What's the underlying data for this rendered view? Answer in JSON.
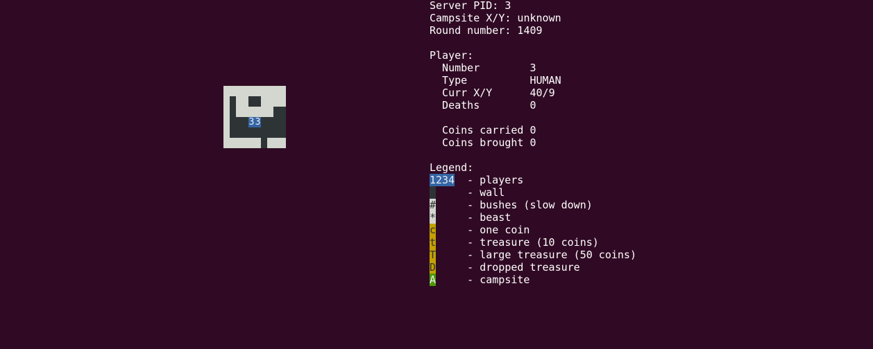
{
  "server": {
    "pid_line": "Server PID: 3",
    "campsite_line": "Campsite X/Y: unknown",
    "round_line": "Round number: 1409"
  },
  "player": {
    "heading": "Player:",
    "number_line": "  Number        3",
    "type_line": "  Type          HUMAN",
    "pos_line": "  Curr X/Y      40/9",
    "deaths_line": "  Deaths        0",
    "coins_carried_line": "  Coins carried 0",
    "coins_brought_line": "  Coins brought 0"
  },
  "legend": {
    "heading": "Legend:",
    "items": [
      {
        "glyph": "1234",
        "text": "  - players"
      },
      {
        "glyph": " ",
        "text": "     - wall"
      },
      {
        "glyph": "#",
        "text": "     - bushes (slow down)"
      },
      {
        "glyph": "*",
        "text": "     - beast"
      },
      {
        "glyph": "c",
        "text": "     - one coin"
      },
      {
        "glyph": "t",
        "text": "     - treasure (10 coins)"
      },
      {
        "glyph": "T",
        "text": "     - large treasure (50 coins)"
      },
      {
        "glyph": "D",
        "text": "     - dropped treasure"
      },
      {
        "glyph": "A",
        "text": "     - campsite"
      }
    ]
  },
  "map": {
    "rows": [
      "..........",
      ".#..##....",
      ".#......##",
      ".###PP####",
      ".#########",
      "......#..."
    ],
    "player_glyphs": "33"
  },
  "colors": {
    "background": "#300a24",
    "floor": "#d3d7cf",
    "wall": "#2e3436",
    "player": "#3465a4",
    "coin": "#c4a000",
    "campsite": "#4e9a06"
  }
}
